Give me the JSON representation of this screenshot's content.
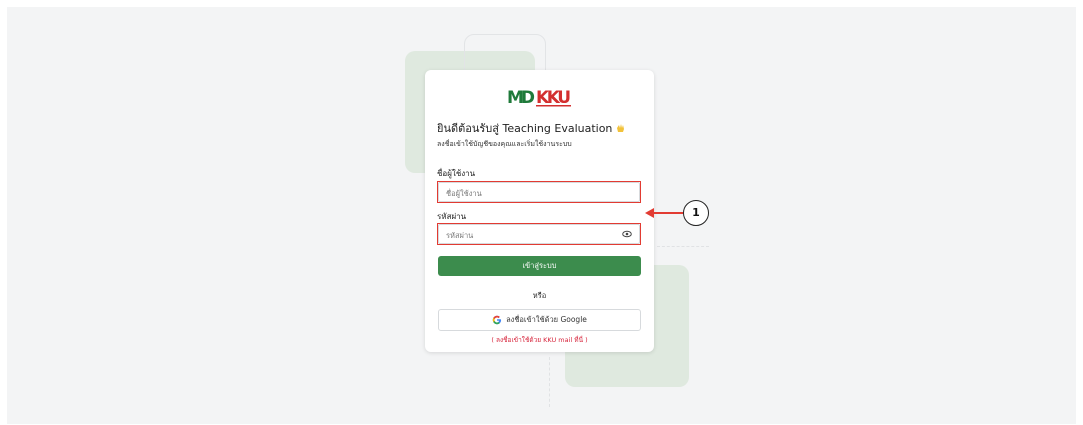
{
  "logo": {
    "text": "MDKKU",
    "brand_green": "#1f7a3a",
    "brand_red": "#d32f2f"
  },
  "header": {
    "title": "ยินดีต้อนรับสู่ Teaching Evaluation",
    "title_emoji": "waving-hand",
    "subtitle": "ลงชื่อเข้าใช้บัญชีของคุณและเริ่มใช้งานระบบ"
  },
  "form": {
    "username_label": "ชื่อผู้ใช้งาน",
    "username_placeholder": "ชื่อผู้ใช้งาน",
    "password_label": "รหัสผ่าน",
    "password_placeholder": "รหัสผ่าน",
    "password_toggle_icon": "eye-icon",
    "login_button": "เข้าสู่ระบบ",
    "or_text": "หรือ",
    "google_button": "ลงชื่อเข้าใช้ด้วย Google",
    "google_icon": "google-g-icon",
    "kku_mail_note": "( ลงชื่อเข้าใช้ด้วย KKU mail ที่นี่ )"
  },
  "annotation": {
    "number": "1",
    "highlight_color": "#e23b32"
  },
  "colors": {
    "primary_button": "#3c8c4d",
    "note_text": "#d7263d",
    "background": "#f3f4f5"
  }
}
